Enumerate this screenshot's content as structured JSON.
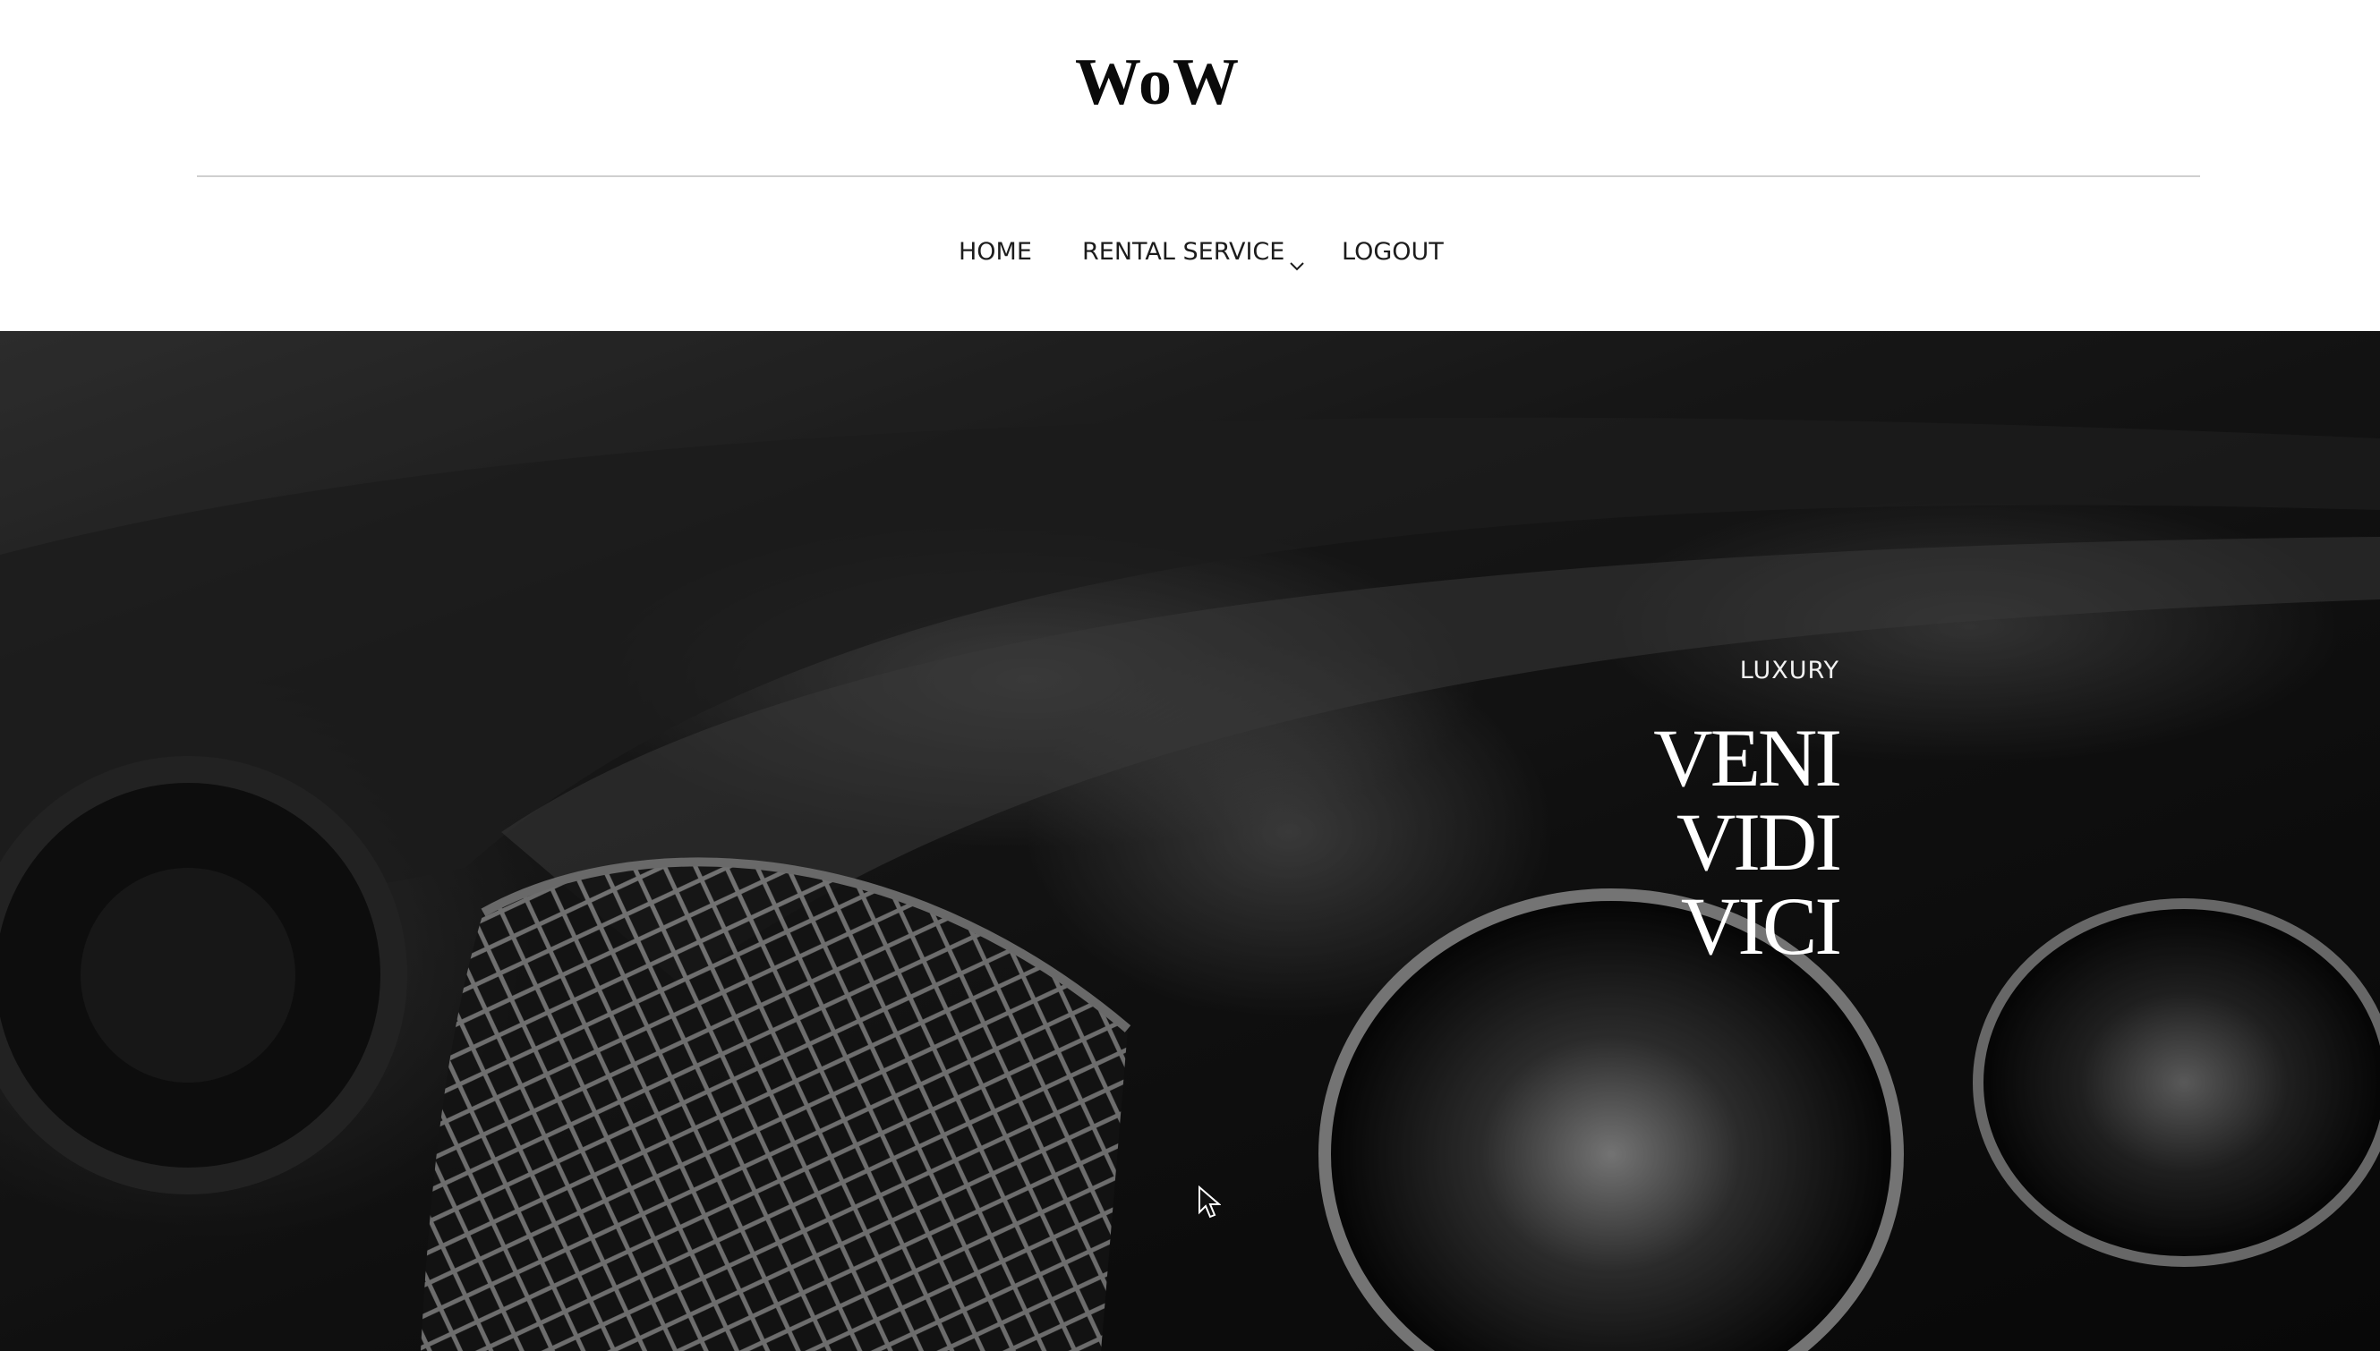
{
  "header": {
    "logo": "WoW"
  },
  "nav": {
    "items": [
      {
        "label": "HOME"
      },
      {
        "label": "RENTAL SERVICE",
        "has_dropdown": true,
        "icon": "chevron-down-icon"
      },
      {
        "label": "LOGOUT"
      }
    ]
  },
  "hero": {
    "eyebrow": "LUXURY",
    "headline": [
      "VENI",
      "VIDI",
      "VICI"
    ],
    "image_subject": "black-and-white close-up of a luxury car front grille and headlights"
  },
  "colors": {
    "background": "#ffffff",
    "text": "#1c1c1c",
    "divider": "#cfcfcf",
    "hero_text": "#ffffff"
  }
}
